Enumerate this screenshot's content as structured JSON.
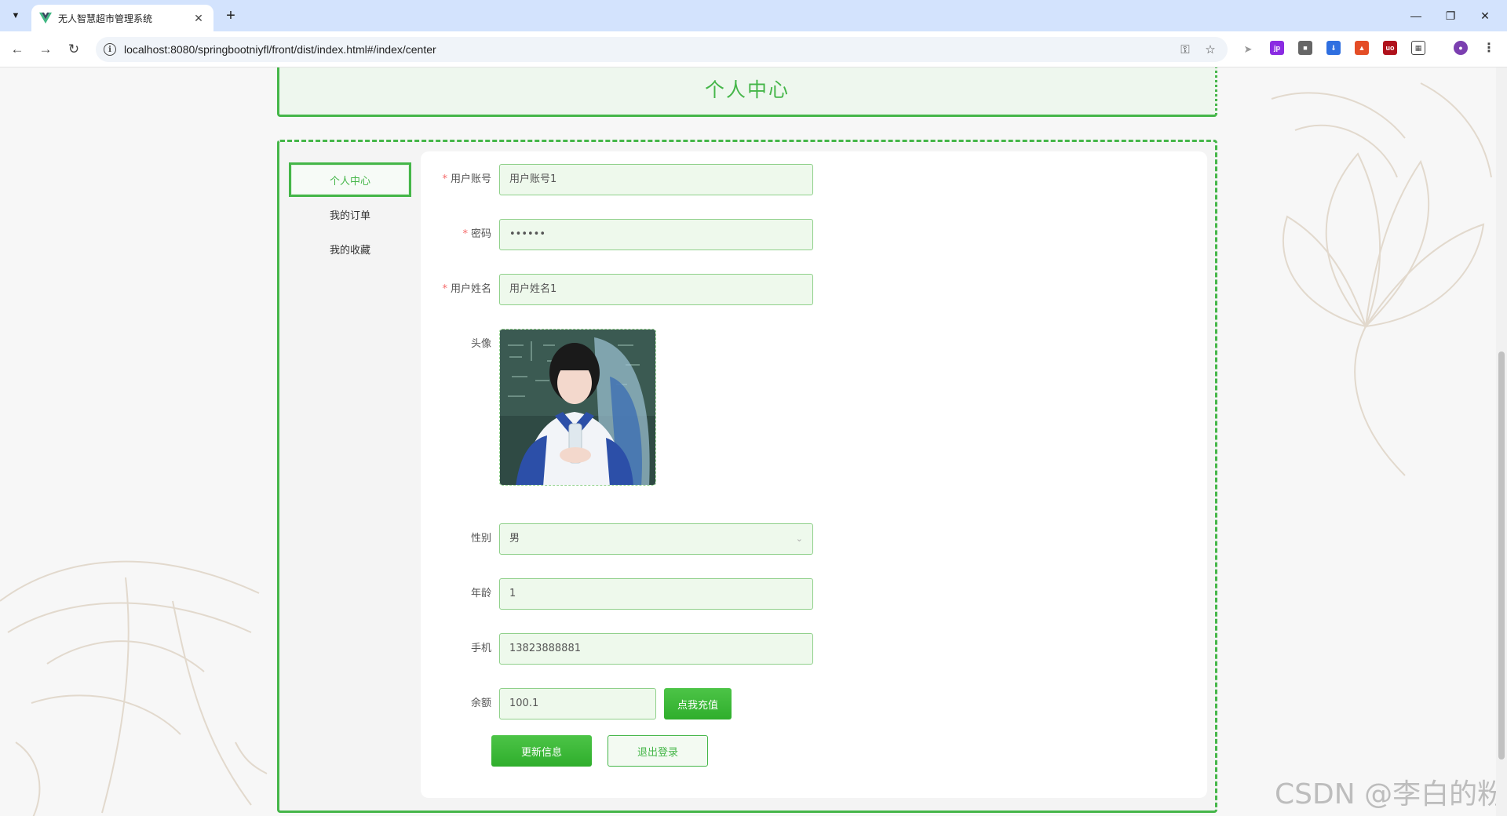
{
  "browser": {
    "tab_title": "无人智慧超市管理系统",
    "url": "localhost:8080/springbootniyfl/front/dist/index.html#/index/center"
  },
  "page": {
    "title": "个人中心",
    "menu": [
      {
        "label": "个人中心",
        "active": true
      },
      {
        "label": "我的订单",
        "active": false
      },
      {
        "label": "我的收藏",
        "active": false
      }
    ]
  },
  "form": {
    "account_label": "用户账号",
    "account_value": "用户账号1",
    "password_label": "密码",
    "password_value": "••••••",
    "name_label": "用户姓名",
    "name_value": "用户姓名1",
    "avatar_label": "头像",
    "gender_label": "性别",
    "gender_value": "男",
    "age_label": "年龄",
    "age_value": "1",
    "phone_label": "手机",
    "phone_value": "13823888881",
    "balance_label": "余额",
    "balance_value": "100.1",
    "recharge_button": "点我充值",
    "update_button": "更新信息",
    "logout_button": "退出登录",
    "required_mark": "*"
  },
  "watermark": "CSDN @李白的粉",
  "colors": {
    "accent": "#45b649",
    "input_bg": "#eef9ec",
    "required": "#f56c6c"
  }
}
